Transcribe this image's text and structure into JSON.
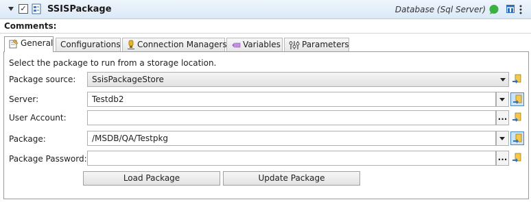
{
  "header": {
    "title": "SSISPackage",
    "db_type": "Database (Sql Server)",
    "checkbox_mark": "✓"
  },
  "comments_label": "Comments:",
  "tabs": [
    {
      "label": "General",
      "icon": "general-settings-icon",
      "active": true
    },
    {
      "label": "Configurations",
      "icon": null,
      "active": false
    },
    {
      "label": "Connection Managers",
      "icon": "connection-managers-icon",
      "active": false
    },
    {
      "label": "Variables",
      "icon": "variables-icon",
      "active": false
    },
    {
      "label": "Parameters",
      "icon": "parameters-icon",
      "active": false
    }
  ],
  "form": {
    "intro": "Select the package to run from a storage location.",
    "package_source": {
      "label": "Package source:",
      "value": "SsisPackageStore"
    },
    "server": {
      "label": "Server:",
      "value": "Testdb2"
    },
    "user_account": {
      "label": "User Account:",
      "value": "",
      "browse": "..."
    },
    "package": {
      "label": "Package:",
      "value": "/MSDB/QA/Testpkg"
    },
    "package_password": {
      "label": "Package Password:",
      "value": "",
      "browse": "..."
    }
  },
  "buttons": {
    "load": "Load Package",
    "update": "Update Package"
  },
  "colors": {
    "header_bg": "#dbe9f7",
    "chat_icon": "#3cb043",
    "layout_icon": "#2f6fbf",
    "selected_button": "#cfe3f7"
  }
}
